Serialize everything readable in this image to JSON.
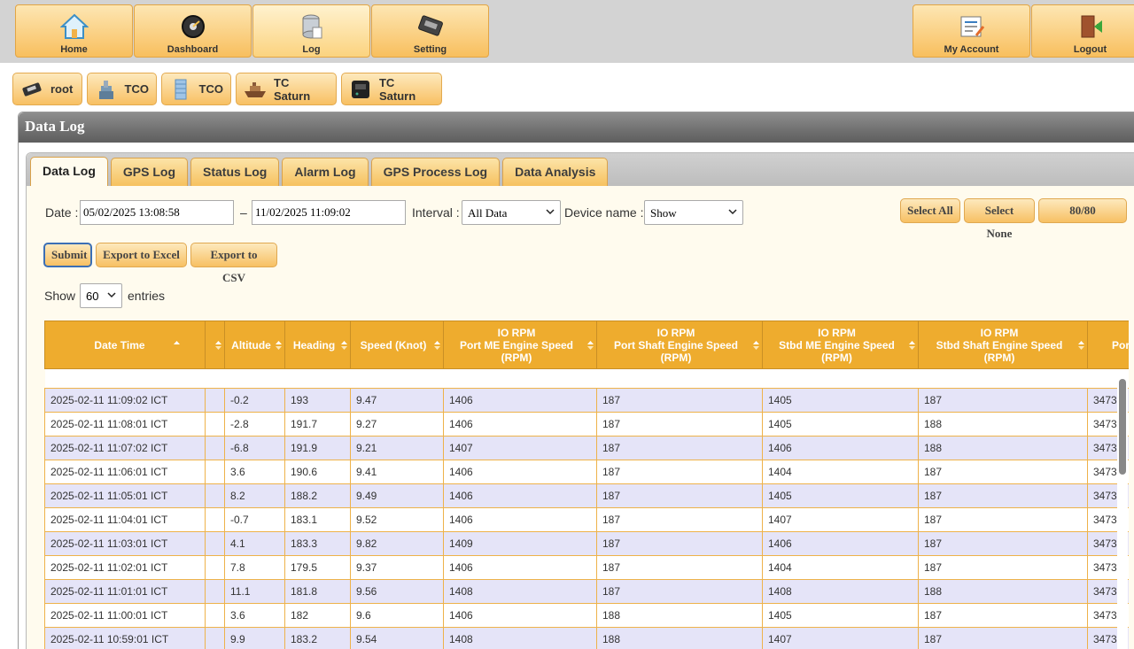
{
  "nav": {
    "left": [
      {
        "label": "Home",
        "icon": "home-icon"
      },
      {
        "label": "Dashboard",
        "icon": "dashboard-icon"
      },
      {
        "label": "Log",
        "icon": "log-icon"
      },
      {
        "label": "Setting",
        "icon": "setting-icon"
      }
    ],
    "right": [
      {
        "label": "My Account",
        "icon": "account-icon"
      },
      {
        "label": "Logout",
        "icon": "logout-icon"
      }
    ],
    "active": "Log"
  },
  "breadcrumbs": [
    {
      "label": "root",
      "icon": "root-device-icon"
    },
    {
      "label": "TCO",
      "icon": "tco-site-icon"
    },
    {
      "label": "TCO",
      "icon": "tco-building-icon"
    },
    {
      "label": "TC Saturn",
      "icon": "ship-icon"
    },
    {
      "label": "TC Saturn",
      "icon": "controller-icon"
    }
  ],
  "panel": {
    "title": "Data Log"
  },
  "tabs": [
    "Data Log",
    "GPS Log",
    "Status Log",
    "Alarm Log",
    "GPS Process Log",
    "Data Analysis"
  ],
  "filters": {
    "date_label": "Date :",
    "date_from": "05/02/2025 13:08:58",
    "date_sep": "–",
    "date_to": "11/02/2025 11:09:02",
    "interval_label": "Interval :",
    "interval_value": "All Data",
    "device_label": "Device name :",
    "device_value": "Show",
    "select_all": "Select All",
    "select_none": "Select None",
    "count": "80/80",
    "submit": "Submit",
    "export_excel": "Export to Excel",
    "export_csv": "Export to CSV"
  },
  "paging": {
    "show_label": "Show",
    "entries_value": "60",
    "entries_label": "entries"
  },
  "table": {
    "headers": [
      [
        "Date Time"
      ],
      [
        ""
      ],
      [
        "Altitude"
      ],
      [
        "Heading"
      ],
      [
        "Speed (Knot)"
      ],
      [
        "IO RPM",
        "Port ME Engine Speed",
        "(RPM)"
      ],
      [
        "IO RPM",
        "Port Shaft Engine Speed",
        "(RPM)"
      ],
      [
        "IO RPM",
        "Stbd ME Engine Speed",
        "(RPM)"
      ],
      [
        "IO RPM",
        "Stbd Shaft Engine Speed",
        "(RPM)"
      ],
      [
        "Por"
      ]
    ],
    "rows": [
      [
        "2025-02-11 11:09:02 ICT",
        "",
        "-0.2",
        "193",
        "9.47",
        "1406",
        "187",
        "1405",
        "187",
        "3473"
      ],
      [
        "2025-02-11 11:08:01 ICT",
        "",
        "-2.8",
        "191.7",
        "9.27",
        "1406",
        "187",
        "1405",
        "188",
        "3473"
      ],
      [
        "2025-02-11 11:07:02 ICT",
        "",
        "-6.8",
        "191.9",
        "9.21",
        "1407",
        "187",
        "1406",
        "188",
        "3473"
      ],
      [
        "2025-02-11 11:06:01 ICT",
        "",
        "3.6",
        "190.6",
        "9.41",
        "1406",
        "187",
        "1404",
        "187",
        "3473"
      ],
      [
        "2025-02-11 11:05:01 ICT",
        "",
        "8.2",
        "188.2",
        "9.49",
        "1406",
        "187",
        "1405",
        "187",
        "3473"
      ],
      [
        "2025-02-11 11:04:01 ICT",
        "",
        "-0.7",
        "183.1",
        "9.52",
        "1406",
        "187",
        "1407",
        "187",
        "3473"
      ],
      [
        "2025-02-11 11:03:01 ICT",
        "",
        "4.1",
        "183.3",
        "9.82",
        "1409",
        "187",
        "1406",
        "187",
        "3473"
      ],
      [
        "2025-02-11 11:02:01 ICT",
        "",
        "7.8",
        "179.5",
        "9.37",
        "1406",
        "187",
        "1404",
        "187",
        "3473"
      ],
      [
        "2025-02-11 11:01:01 ICT",
        "",
        "11.1",
        "181.8",
        "9.56",
        "1408",
        "187",
        "1408",
        "188",
        "3473"
      ],
      [
        "2025-02-11 11:00:01 ICT",
        "",
        "3.6",
        "182",
        "9.6",
        "1406",
        "188",
        "1405",
        "187",
        "3473"
      ],
      [
        "2025-02-11 10:59:01 ICT",
        "",
        "9.9",
        "183.2",
        "9.54",
        "1408",
        "188",
        "1407",
        "187",
        "3473"
      ]
    ]
  }
}
